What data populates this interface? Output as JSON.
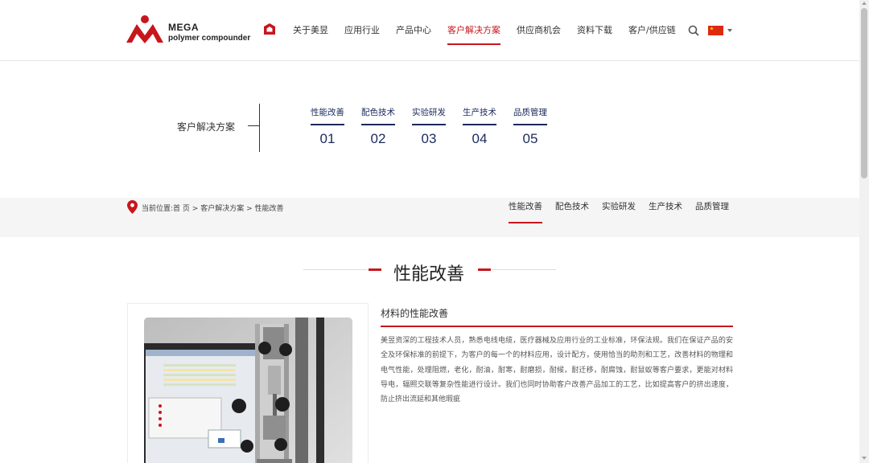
{
  "header": {
    "logo_line1": "MEGA",
    "logo_line2": "polymer compounder",
    "nav": [
      {
        "label": "关于美昱",
        "active": false
      },
      {
        "label": "应用行业",
        "active": false
      },
      {
        "label": "产品中心",
        "active": false
      },
      {
        "label": "客户解决方案",
        "active": true
      },
      {
        "label": "供应商机会",
        "active": false
      },
      {
        "label": "资料下载",
        "active": false
      },
      {
        "label": "客户/供应链",
        "active": false
      }
    ],
    "accent_color": "#c8161d"
  },
  "hero": {
    "title": "客户解决方案",
    "steps": [
      {
        "label": "性能改善",
        "num": "01"
      },
      {
        "label": "配色技术",
        "num": "02"
      },
      {
        "label": "实验研发",
        "num": "03"
      },
      {
        "label": "生产技术",
        "num": "04"
      },
      {
        "label": "品质管理",
        "num": "05"
      }
    ],
    "step_color": "#1b2a5c"
  },
  "breadcrumb": {
    "prefix": "当前位置:",
    "home": "首 页",
    "sep1": " > ",
    "level1": "客户解决方案",
    "sep2": " > ",
    "current": "性能改善"
  },
  "subnav": [
    {
      "label": "性能改善",
      "active": true
    },
    {
      "label": "配色技术",
      "active": false
    },
    {
      "label": "实验研发",
      "active": false
    },
    {
      "label": "生产技术",
      "active": false
    },
    {
      "label": "品质管理",
      "active": false
    }
  ],
  "section": {
    "title": "性能改善"
  },
  "content": {
    "title": "材料的性能改善",
    "body": "美昱资深的工程技术人员，熟悉电线电缆，医疗器械及应用行业的工业标准，环保法规。我们在保证产品的安全及环保标准的前提下，为客户的每一个的材料应用，设计配方，使用恰当的助剂和工艺，改善材料的物理和电气性能，处理阻燃，老化，耐油，耐寒，耐磨损，耐候，耐迁移，耐腐蚀，耐鼠蚁等客户要求，更能对材料导电，辐照交联等复杂性能进行设计。我们也同时协助客户改善产品加工的工艺，比如提高客户的挤出速度，防止挤出流延和其他瑕疵"
  },
  "icons": {
    "home": "home-icon",
    "search": "search-icon",
    "flag": "china-flag-icon",
    "pin": "location-pin-icon"
  }
}
